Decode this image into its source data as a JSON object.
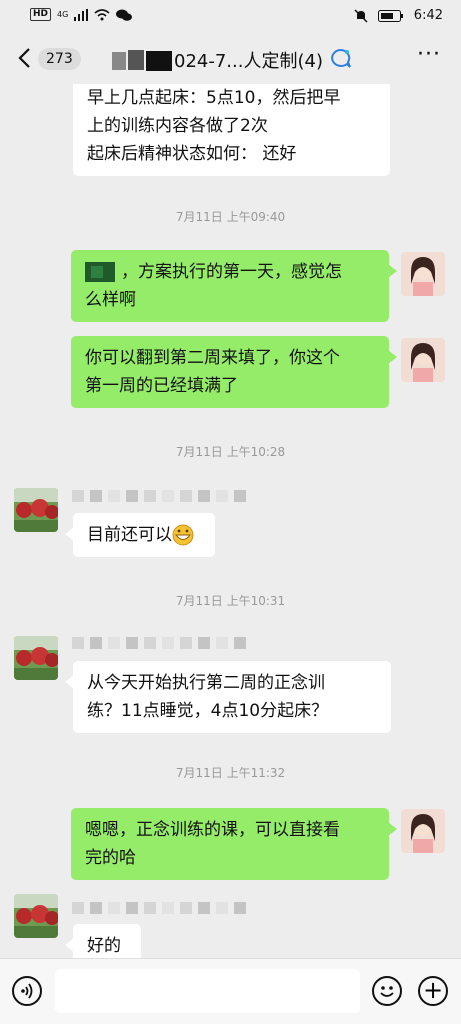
{
  "status_bar": {
    "hd": "HD",
    "net": "4G",
    "time": "6:42"
  },
  "header": {
    "unread_count": "273",
    "title": "024-7...人定制(4)"
  },
  "messages": [
    {
      "side": "left",
      "lines": [
        "早上几点起床：5点10，然后把早",
        "上的训练内容各做了2次",
        "起床后精神状态如何：  还好"
      ]
    },
    {
      "type": "time",
      "text": "7月11日 上午09:40"
    },
    {
      "side": "right",
      "lines": [
        "，方案执行的第一天，感觉怎",
        "么样啊"
      ]
    },
    {
      "side": "right",
      "lines": [
        "你可以翻到第二周来填了，你这个",
        "第一周的已经填满了"
      ]
    },
    {
      "type": "time",
      "text": "7月11日 上午10:28"
    },
    {
      "side": "left",
      "lines": [
        "目前还可以"
      ],
      "emoji": "grin-emoji"
    },
    {
      "type": "time",
      "text": "7月11日 上午10:31"
    },
    {
      "side": "left",
      "lines": [
        "从今天开始执行第二周的正念训",
        "练？11点睡觉，4点10分起床？"
      ]
    },
    {
      "type": "time",
      "text": "7月11日 上午11:32"
    },
    {
      "side": "right",
      "lines": [
        "嗯嗯，正念训练的课，可以直接看",
        "完的哈"
      ]
    },
    {
      "side": "left",
      "lines": [
        "好的"
      ]
    }
  ],
  "colors": {
    "bubble_green": "#95ec69",
    "background": "#ededed"
  }
}
